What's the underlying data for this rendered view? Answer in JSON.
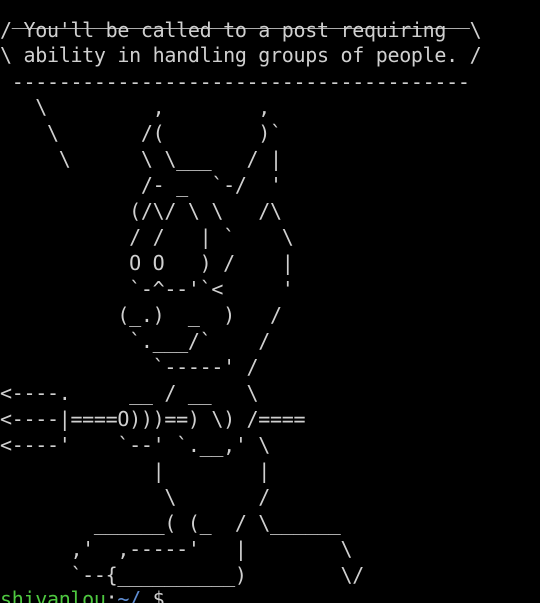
{
  "terminal": {
    "lines": [
      " _______________________________________",
      "/ You'll be called to a post requiring  \\",
      "\\ ability in handling groups of people. /",
      " ---------------------------------------",
      "   \\         ,        ,",
      "    \\       /(        )`",
      "     \\      \\ \\___   / |",
      "            /- _  `-/  '",
      "           (/\\/ \\ \\   /\\",
      "           / /   | `    \\",
      "           O O   ) /    |",
      "           `-^--'`<     '",
      "          (_.)  _  )   /",
      "           `.___/`    /",
      "             `-----' /",
      "<----.     __ / __   \\",
      "<----|====O)))==) \\) /====",
      "<----'    `--' `.__,' \\",
      "             |        |",
      "              \\       /",
      "        ______( (_  / \\______",
      "      ,'  ,-----'   |        \\",
      "      `--{__________)        \\/"
    ],
    "prompt": {
      "user_host": "shivanlou",
      "separator": ":",
      "path": "~/",
      "symbol": " $"
    }
  },
  "colors": {
    "background": "#000000",
    "text": "#d0d0d0",
    "prompt_user": "#4ec940",
    "prompt_path": "#5f8dd3"
  }
}
